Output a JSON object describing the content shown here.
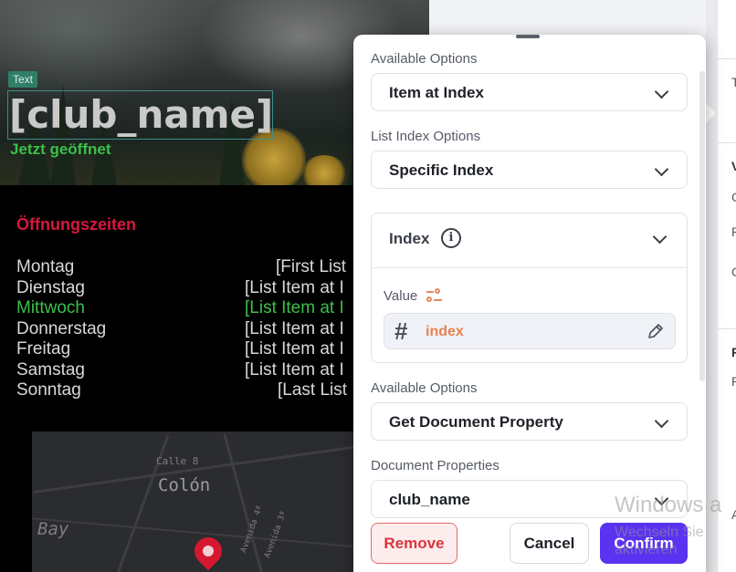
{
  "canvas": {
    "text_badge": "Text",
    "club_name": "[club_name]",
    "open_status": "Jetzt geöffnet",
    "hours_title": "Öffnungszeiten",
    "hours": [
      {
        "day": "Montag",
        "value": "[First List"
      },
      {
        "day": "Dienstag",
        "value": "[List Item at I"
      },
      {
        "day": "Mittwoch",
        "value": "[List Item at I"
      },
      {
        "day": "Donnerstag",
        "value": "[List Item at I"
      },
      {
        "day": "Freitag",
        "value": "[List Item at I"
      },
      {
        "day": "Samstag",
        "value": "[List Item at I"
      },
      {
        "day": "Sonntag",
        "value": "[Last List"
      }
    ],
    "map": {
      "labels": [
        "Calle 8",
        "Colón",
        "Bay",
        "Avenida 4ª",
        "Avenida 3ª"
      ]
    }
  },
  "popup": {
    "section1": {
      "label": "Available Options",
      "value": "Item at Index"
    },
    "section2": {
      "label": "List Index Options",
      "value": "Specific Index"
    },
    "index_card": {
      "title": "Index",
      "value_label": "Value",
      "value": "index"
    },
    "section3": {
      "label": "Available Options",
      "value": "Get Document Property"
    },
    "section4": {
      "label": "Document Properties",
      "value": "club_name"
    },
    "buttons": {
      "remove": "Remove",
      "cancel": "Cancel",
      "confirm": "Confirm"
    }
  },
  "right_panel": {
    "fragments": [
      "T",
      "V",
      "C",
      "P",
      "C",
      "P",
      "P",
      "A"
    ]
  },
  "watermark": {
    "line1": "Windows a",
    "line2": "Wechseln Sie",
    "line3": "aktivieren"
  },
  "colors": {
    "accent": "#5a33f0",
    "open_green": "#3cc04a",
    "hours_title_red": "#d6173e",
    "binding_orange": "#e6834f"
  }
}
